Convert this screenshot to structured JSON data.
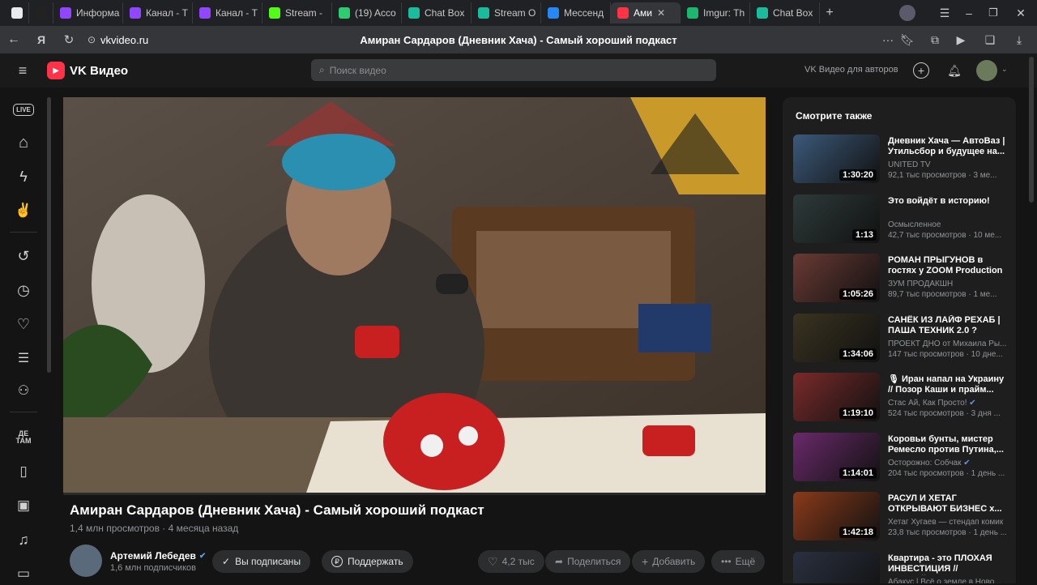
{
  "browser": {
    "tabs": [
      {
        "label": "",
        "color": "#e8eaed"
      },
      {
        "label": "D:",
        "color": "#222222"
      },
      {
        "label": "Информа",
        "color": "#9146ff"
      },
      {
        "label": "Канал - Т",
        "color": "#9146ff"
      },
      {
        "label": "Канал - Т",
        "color": "#9146ff"
      },
      {
        "label": "Stream - ",
        "color": "#53fc18"
      },
      {
        "label": "(19) Acco",
        "color": "#2ecc71"
      },
      {
        "label": "Chat Box",
        "color": "#1abc9c"
      },
      {
        "label": "Stream O",
        "color": "#1abc9c"
      },
      {
        "label": "Мессенд",
        "color": "#2787f5"
      },
      {
        "label": "Ами",
        "color": "#ff3347",
        "active": true
      },
      {
        "label": "Imgur: Th",
        "color": "#1bb76e"
      },
      {
        "label": "Chat Box",
        "color": "#1abc9c"
      }
    ],
    "url": "vkvideo.ru",
    "page_title": "Амиран Сардаров (Дневник Хача) - Самый хороший подкаст"
  },
  "header": {
    "logo": "VK Видео",
    "search_placeholder": "Поиск видео",
    "for_authors": "VK Видео для авторов"
  },
  "sidebar": {
    "live_label": "LIVE",
    "kids_label": "ДЕ ТАМ",
    "icons": [
      "live-icon",
      "home-icon",
      "lightning-icon",
      "hand-icon",
      "history-icon",
      "clock-icon",
      "heart-icon",
      "playlist-add-icon",
      "community-icon",
      "kids-icon",
      "book-icon",
      "clips-icon",
      "music-icon",
      "tv-icon"
    ]
  },
  "video": {
    "title": "Амиран Сардаров (Дневник Хача) - Самый хороший подкаст",
    "views": "1,4 млн просмотров",
    "age": "4 месяца назад",
    "channel": "Артемий Лебедев",
    "subscribers": "1,6 млн подписчиков",
    "subscribed_label": "Вы подписаны",
    "support_label": "Поддержать",
    "likes": "4,2 тыс",
    "share_label": "Поделиться",
    "add_label": "Добавить",
    "more_label": "Ещё"
  },
  "recommendations": {
    "heading": "Смотрите также",
    "items": [
      {
        "title": "Дневник Хача — АвтоВаз | Утильсбор и будущее на...",
        "channel": "UNITED TV",
        "views": "92,1 тыс просмотров · 3 ме...",
        "duration": "1:30:20",
        "color": "#3c5a7a"
      },
      {
        "title": "Это войдёт в историю!",
        "channel": "Осмысленное",
        "views": "42,7 тыс просмотров · 10 ме...",
        "duration": "1:13",
        "color": "#2e3a3a"
      },
      {
        "title": "РОМАН ПРЫГУНОВ в гостях у ZOOM Production",
        "channel": "ЗУМ ПРОДАКШН",
        "views": "89,7 тыс просмотров · 1 ме...",
        "duration": "1:05:26",
        "color": "#6a3a34"
      },
      {
        "title": "САНЁК ИЗ ЛАЙФ РЕХАБ | ПАША ТЕХНИК 2.0 ?",
        "channel": "ПРОЕКТ ДНО от Михаила Ры...",
        "views": "147 тыс просмотров · 10 дне...",
        "duration": "1:34:06",
        "color": "#3a3320"
      },
      {
        "title": "🎙 Иран напал на Украину // Позор Каши и прайм...",
        "channel": "Стас Ай, Как Просто!",
        "views": "524 тыс просмотров · 3 дня ...",
        "duration": "1:19:10",
        "color": "#7a2a2a",
        "verified": true
      },
      {
        "title": "Коровьи бунты, мистер Ремесло против Путина,...",
        "channel": "Осторожно: Собчак",
        "views": "204 тыс просмотров · 1 день ...",
        "duration": "1:14:01",
        "color": "#6a2a6a",
        "verified": true
      },
      {
        "title": "РАСУЛ И ХЕТАГ ОТКРЫВАЮТ БИЗНЕС х...",
        "channel": "Хетаг Хугаев — стендап комик",
        "views": "23,8 тыс просмотров · 1 день ...",
        "duration": "1:42:18",
        "color": "#8a3a1a"
      },
      {
        "title": "Квартира - это ПЛОХАЯ ИНВЕСТИЦИЯ // Артемий...",
        "channel": "Абакус | Всё о земле в Ново...",
        "views": "",
        "duration": "",
        "color": "#2a3040"
      }
    ]
  }
}
